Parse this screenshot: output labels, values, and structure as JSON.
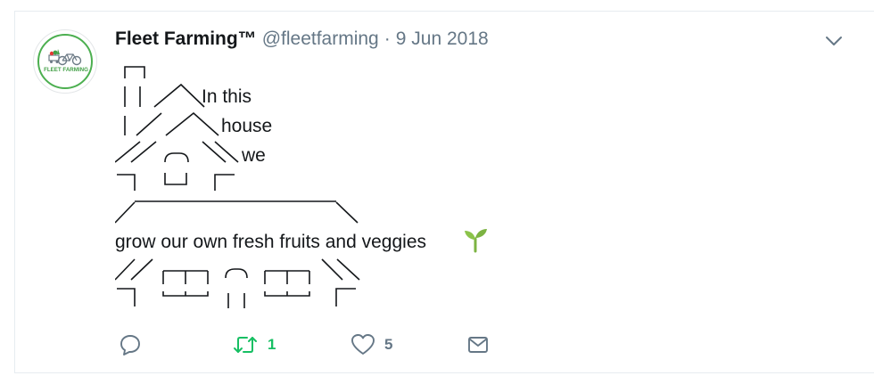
{
  "tweet": {
    "author": {
      "display_name": "Fleet Farming™",
      "handle": "@fleetfarming",
      "avatar_text": "FLEET FARMING"
    },
    "separator": "·",
    "date": "9 Jun 2018",
    "art_lines": {
      "line1": "In this",
      "line2": "house",
      "line3": "we",
      "line4": "grow our own fresh fruits and veggies"
    },
    "emoji": "seedling-icon",
    "actions": {
      "reply": {
        "icon": "reply-icon"
      },
      "retweet": {
        "icon": "retweet-icon",
        "count": "1"
      },
      "like": {
        "icon": "heart-icon",
        "count": "5"
      },
      "message": {
        "icon": "envelope-icon"
      }
    },
    "menu_icon": "chevron-down-icon"
  },
  "colors": {
    "retweet_green": "#17bf63",
    "icon_gray": "#657786",
    "brand_green": "#4caf50"
  }
}
